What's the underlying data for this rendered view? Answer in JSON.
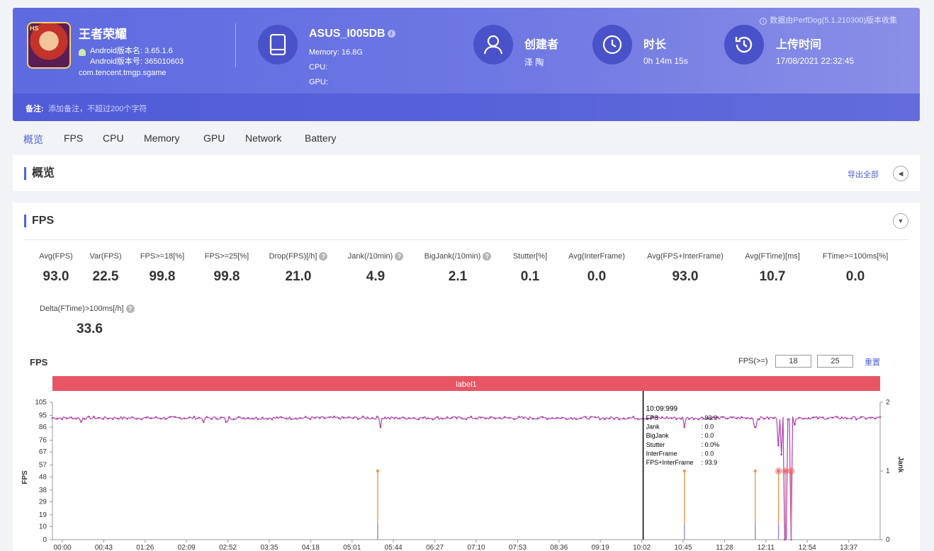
{
  "header": {
    "app_name": "王者荣耀",
    "android_version_name": "Android版本名: 3.65.1.6",
    "android_version_code": "Android版本号: 365010603",
    "package": "com.tencent.tmgp.sgame",
    "device": {
      "name": "ASUS_I005DB",
      "memory": "Memory: 16.8G",
      "cpu": "CPU:",
      "gpu": "GPU:"
    },
    "creator": {
      "title": "创建者",
      "value": "泽 陶"
    },
    "duration": {
      "title": "时长",
      "value": "0h 14m 15s"
    },
    "upload": {
      "title": "上传时间",
      "value": "17/08/2021 22:32:45"
    },
    "source_note": "数据由PerfDog(5.1.210300)版本收集",
    "note_label": "备注:",
    "note_placeholder": "添加备注，不超过200个字符"
  },
  "tabs": [
    "概览",
    "FPS",
    "CPU",
    "Memory",
    "GPU",
    "Network",
    "Battery"
  ],
  "overview": {
    "title": "概览",
    "export_label": "导出全部"
  },
  "fps": {
    "title": "FPS",
    "stats": [
      {
        "key": "Avg(FPS)",
        "value": "93.0",
        "help": false
      },
      {
        "key": "Var(FPS)",
        "value": "22.5",
        "help": false
      },
      {
        "key": "FPS>=18[%]",
        "value": "99.8",
        "help": false
      },
      {
        "key": "FPS>=25[%]",
        "value": "99.8",
        "help": false
      },
      {
        "key": "Drop(FPS)[/h]",
        "value": "21.0",
        "help": true
      },
      {
        "key": "Jank(/10min)",
        "value": "4.9",
        "help": true
      },
      {
        "key": "BigJank(/10min)",
        "value": "2.1",
        "help": true
      },
      {
        "key": "Stutter[%]",
        "value": "0.1",
        "help": false
      },
      {
        "key": "Avg(InterFrame)",
        "value": "0.0",
        "help": false
      },
      {
        "key": "Avg(FPS+InterFrame)",
        "value": "93.0",
        "help": false
      },
      {
        "key": "Avg(FTime)[ms]",
        "value": "10.7",
        "help": false
      },
      {
        "key": "FTime>=100ms[%]",
        "value": "0.0",
        "help": false
      },
      {
        "key": "Delta(FTime)>100ms[/h]",
        "value": "33.6",
        "help": true
      }
    ],
    "chart_title": "FPS",
    "threshold_label": "FPS(>=)",
    "threshold_low": "18",
    "threshold_high": "25",
    "reset_label": "重置",
    "band_label": "label1",
    "tooltip": {
      "time": "10:09:999",
      "rows": [
        {
          "k": "FPS",
          "v": ": 93.9"
        },
        {
          "k": "Jank",
          "v": ": 0.0"
        },
        {
          "k": "BigJank",
          "v": ": 0.0"
        },
        {
          "k": "Stutter",
          "v": ": 0.0%"
        },
        {
          "k": "InterFrame",
          "v": ": 0.0"
        },
        {
          "k": "FPS+InterFrame",
          "v": ": 93.9"
        }
      ]
    }
  },
  "colors": {
    "accent": "#4b63d8",
    "fps_line": "#b040b0",
    "jank": "#e8904a",
    "band": "#e85565"
  },
  "chart_data": {
    "type": "line",
    "ylabel": "FPS",
    "y2label": "Jank",
    "ylim": [
      0,
      105
    ],
    "y2lim": [
      0,
      2
    ],
    "y_ticks": [
      "0",
      "10",
      "19",
      "29",
      "38",
      "48",
      "57",
      "67",
      "76",
      "86",
      "95",
      "105"
    ],
    "y2_ticks": [
      "0",
      "1",
      "2"
    ],
    "x_ticks": [
      "00:00",
      "00:43",
      "01:26",
      "02:09",
      "02:52",
      "03:35",
      "04:18",
      "05:01",
      "05:44",
      "06:27",
      "07:10",
      "07:53",
      "08:36",
      "09:19",
      "10:02",
      "10:45",
      "11:28",
      "12:11",
      "12:54",
      "13:37"
    ],
    "series": [
      {
        "name": "FPS",
        "baseline": 93,
        "dips": [
          {
            "t": 0.5,
            "v": 90
          },
          {
            "t": 2.6,
            "v": 90
          },
          {
            "t": 3.0,
            "v": 90
          },
          {
            "t": 5.65,
            "v": 86
          },
          {
            "t": 10.88,
            "v": 86
          },
          {
            "t": 12.1,
            "v": 86
          },
          {
            "t": 12.5,
            "v": 72
          },
          {
            "t": 12.55,
            "v": 65
          },
          {
            "t": 12.62,
            "v": 0
          },
          {
            "t": 12.72,
            "v": 0
          },
          {
            "t": 12.78,
            "v": 88
          }
        ]
      },
      {
        "name": "Jank",
        "values": [
          {
            "t": 5.6,
            "v": 1
          },
          {
            "t": 10.88,
            "v": 1
          },
          {
            "t": 12.1,
            "v": 1
          },
          {
            "t": 12.5,
            "v": 1
          },
          {
            "t": 12.62,
            "v": 1
          },
          {
            "t": 12.72,
            "v": 1
          }
        ]
      }
    ],
    "cursor_time": 10.17,
    "duration_min": 14.25
  }
}
